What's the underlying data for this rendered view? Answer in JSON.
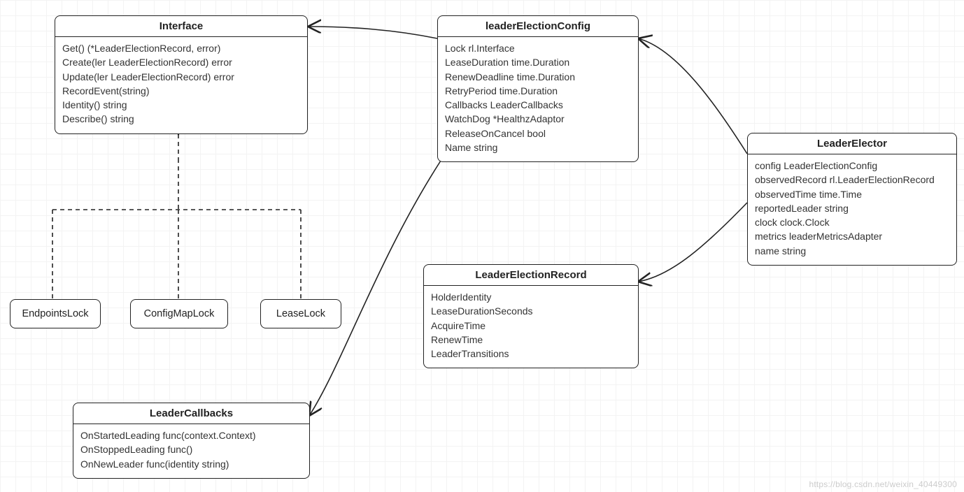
{
  "diagram": {
    "interface": {
      "title": "Interface",
      "lines": [
        "Get() (*LeaderElectionRecord, error)",
        "Create(ler LeaderElectionRecord) error",
        "Update(ler LeaderElectionRecord) error",
        "RecordEvent(string)",
        "Identity() string",
        "Describe() string"
      ]
    },
    "leaderElectionConfig": {
      "title": "leaderElectionConfig",
      "lines": [
        "Lock rl.Interface",
        "LeaseDuration time.Duration",
        "RenewDeadline time.Duration",
        "RetryPeriod time.Duration",
        "Callbacks LeaderCallbacks",
        "WatchDog *HealthzAdaptor",
        "ReleaseOnCancel bool",
        "Name string"
      ]
    },
    "leaderElector": {
      "title": "LeaderElector",
      "lines": [
        "config LeaderElectionConfig",
        "observedRecord rl.LeaderElectionRecord",
        "observedTime   time.Time",
        "reportedLeader string",
        "clock clock.Clock",
        "metrics leaderMetricsAdapter",
        "name string"
      ]
    },
    "leaderElectionRecord": {
      "title": "LeaderElectionRecord",
      "lines": [
        "HolderIdentity",
        "LeaseDurationSeconds",
        "AcquireTime",
        "RenewTime",
        "LeaderTransitions"
      ]
    },
    "leaderCallbacks": {
      "title": "LeaderCallbacks",
      "lines": [
        "OnStartedLeading func(context.Context)",
        "OnStoppedLeading func()",
        "OnNewLeader func(identity string)"
      ]
    },
    "endpointsLock": {
      "label": "EndpointsLock"
    },
    "configMapLock": {
      "label": "ConfigMapLock"
    },
    "leaseLock": {
      "label": "LeaseLock"
    }
  },
  "watermark": "https://blog.csdn.net/weixin_40449300",
  "chart_data": {
    "type": "diagram",
    "title": "UML class-like diagram: Kubernetes leader election components",
    "nodes": [
      {
        "id": "Interface",
        "kind": "interface",
        "members": [
          "Get() (*LeaderElectionRecord, error)",
          "Create(ler LeaderElectionRecord) error",
          "Update(ler LeaderElectionRecord) error",
          "RecordEvent(string)",
          "Identity() string",
          "Describe() string"
        ]
      },
      {
        "id": "leaderElectionConfig",
        "kind": "struct",
        "members": [
          "Lock rl.Interface",
          "LeaseDuration time.Duration",
          "RenewDeadline time.Duration",
          "RetryPeriod time.Duration",
          "Callbacks LeaderCallbacks",
          "WatchDog *HealthzAdaptor",
          "ReleaseOnCancel bool",
          "Name string"
        ]
      },
      {
        "id": "LeaderElector",
        "kind": "struct",
        "members": [
          "config LeaderElectionConfig",
          "observedRecord rl.LeaderElectionRecord",
          "observedTime time.Time",
          "reportedLeader string",
          "clock clock.Clock",
          "metrics leaderMetricsAdapter",
          "name string"
        ]
      },
      {
        "id": "LeaderElectionRecord",
        "kind": "struct",
        "members": [
          "HolderIdentity",
          "LeaseDurationSeconds",
          "AcquireTime",
          "RenewTime",
          "LeaderTransitions"
        ]
      },
      {
        "id": "LeaderCallbacks",
        "kind": "struct",
        "members": [
          "OnStartedLeading func(context.Context)",
          "OnStoppedLeading func()",
          "OnNewLeader func(identity string)"
        ]
      },
      {
        "id": "EndpointsLock",
        "kind": "struct",
        "members": []
      },
      {
        "id": "ConfigMapLock",
        "kind": "struct",
        "members": []
      },
      {
        "id": "LeaseLock",
        "kind": "struct",
        "members": []
      }
    ],
    "edges": [
      {
        "from": "EndpointsLock",
        "to": "Interface",
        "relation": "realization",
        "style": "dashed"
      },
      {
        "from": "ConfigMapLock",
        "to": "Interface",
        "relation": "realization",
        "style": "dashed"
      },
      {
        "from": "LeaseLock",
        "to": "Interface",
        "relation": "realization",
        "style": "dashed"
      },
      {
        "from": "leaderElectionConfig",
        "to": "Interface",
        "relation": "association",
        "style": "solid"
      },
      {
        "from": "leaderElectionConfig",
        "to": "LeaderCallbacks",
        "relation": "association",
        "style": "solid"
      },
      {
        "from": "LeaderElector",
        "to": "leaderElectionConfig",
        "relation": "association",
        "style": "solid"
      },
      {
        "from": "LeaderElector",
        "to": "LeaderElectionRecord",
        "relation": "association",
        "style": "solid"
      }
    ]
  }
}
